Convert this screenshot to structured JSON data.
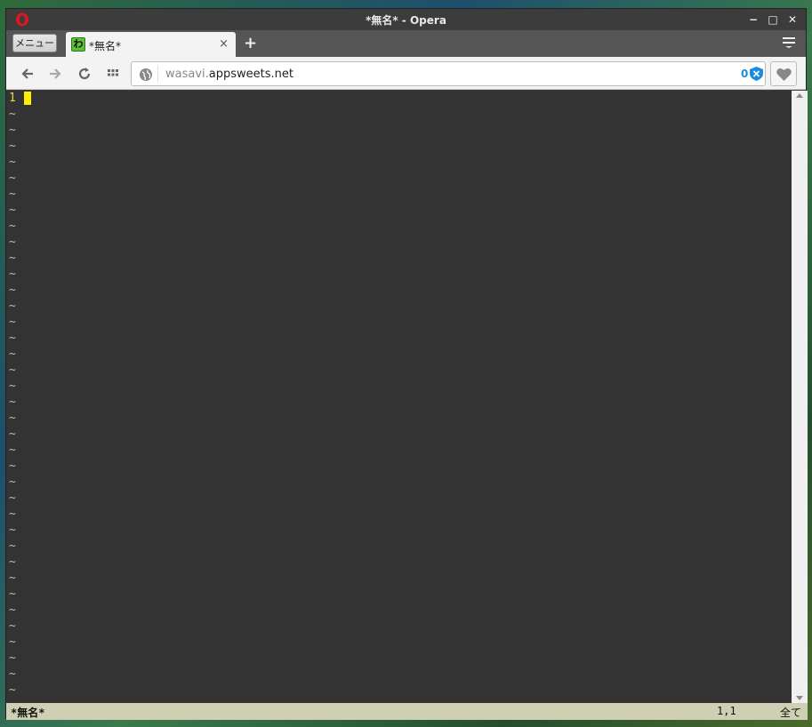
{
  "window": {
    "title": "*無名* - Opera",
    "minimize_glyph": "−",
    "maximize_glyph": "□",
    "close_glyph": "✕"
  },
  "tabbar": {
    "menu_label": "メニュー",
    "tab": {
      "favicon_text": "わ",
      "title": "*無名*",
      "close_glyph": "×"
    },
    "new_tab_glyph": "+"
  },
  "toolbar": {
    "url_subdomain": "wasavi.",
    "url_domain": "appsweets.net",
    "blocked_count": "0"
  },
  "editor": {
    "first_line_number": "1",
    "empty_line_marker": "~",
    "empty_line_count": 37
  },
  "statusline": {
    "filename": "*無名*",
    "position": "1,1",
    "scroll_indicator": "全て"
  },
  "colors": {
    "editor_bg": "#333333",
    "cursor": "#ffee00",
    "line_number": "#e8d84a",
    "status_bg": "#cfcfb3",
    "accent_blue": "#1a8de0",
    "opera_red": "#e0161f"
  },
  "icons": {
    "logo": "opera-logo-icon",
    "back": "back-arrow-icon",
    "forward": "forward-arrow-icon",
    "reload": "reload-icon",
    "speed_dial": "grid-icon",
    "site_info": "globe-icon",
    "shield": "shield-icon",
    "bookmark": "heart-icon",
    "tab_menu": "tab-menu-icon"
  }
}
